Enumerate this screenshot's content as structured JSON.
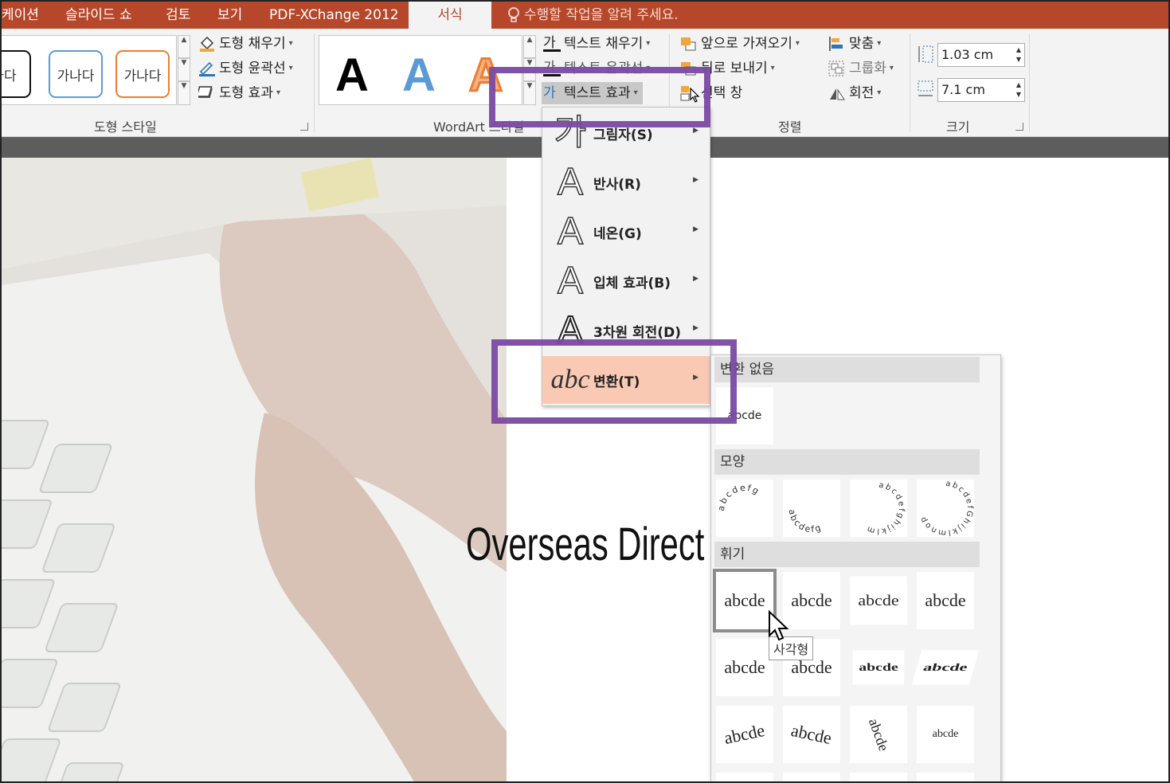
{
  "tabs": {
    "t1": "케이션",
    "t2": "슬라이드 쇼",
    "t3": "검토",
    "t4": "보기",
    "t5": "PDF-XChange 2012",
    "active": "서식",
    "tellme": "수행할 작업을 알려 주세요."
  },
  "shape_styles": {
    "s1": "나다",
    "s2": "가나다",
    "s3": "가나다",
    "fill": "도형 채우기",
    "outline": "도형 윤곽선",
    "effects": "도형 효과",
    "group_label": "도형 스타일"
  },
  "wordart": {
    "letter": "A",
    "text_fill": "텍스트 채우기",
    "text_outline": "텍스트 윤곽선",
    "text_effects": "텍스트 효과",
    "text_icon": "가",
    "group_label": "WordArt 스타일"
  },
  "arrange": {
    "bring_forward": "앞으로 가져오기",
    "send_backward": "뒤로 보내기",
    "selection_pane": "선택 창",
    "align": "맞춤",
    "group": "그룹화",
    "rotate": "회전",
    "group_label": "정렬"
  },
  "size": {
    "height": "1.03 cm",
    "width": "7.1 cm",
    "group_label": "크기"
  },
  "effects_menu": {
    "shadow": {
      "label": "그림자(S)",
      "glyph": "가"
    },
    "reflection": {
      "label": "반사(R)",
      "glyph": "A"
    },
    "glow": {
      "label": "네온(G)",
      "glyph": "A"
    },
    "bevel": {
      "label": "입체 효과(B)",
      "glyph": "A"
    },
    "rotation3d": {
      "label": "3차원 회전(D)",
      "glyph": "A"
    },
    "transform": {
      "label": "변환(T)",
      "glyph": "abc"
    }
  },
  "transform_panel": {
    "no_transform": "변환 없음",
    "follow_path": "모양",
    "warp": "휘기",
    "sample": "abcde",
    "path_samples": [
      "abcdefg",
      "abcdefg",
      "abcdefghijklm",
      "abcdefGhijklmnop"
    ],
    "warp_samples": [
      "abcde",
      "abcde",
      "abcde",
      "abcde",
      "abcde",
      "abcde",
      "abcde",
      "abcde",
      "abcde",
      "abcde",
      "abcde",
      "abcde"
    ],
    "tooltip": "사각형"
  },
  "slide": {
    "title": "Overseas Direct Pur"
  },
  "colors": {
    "accent": "#b7472a",
    "highlight": "#7a4aa3",
    "menu_hover": "#f9c9b4"
  }
}
